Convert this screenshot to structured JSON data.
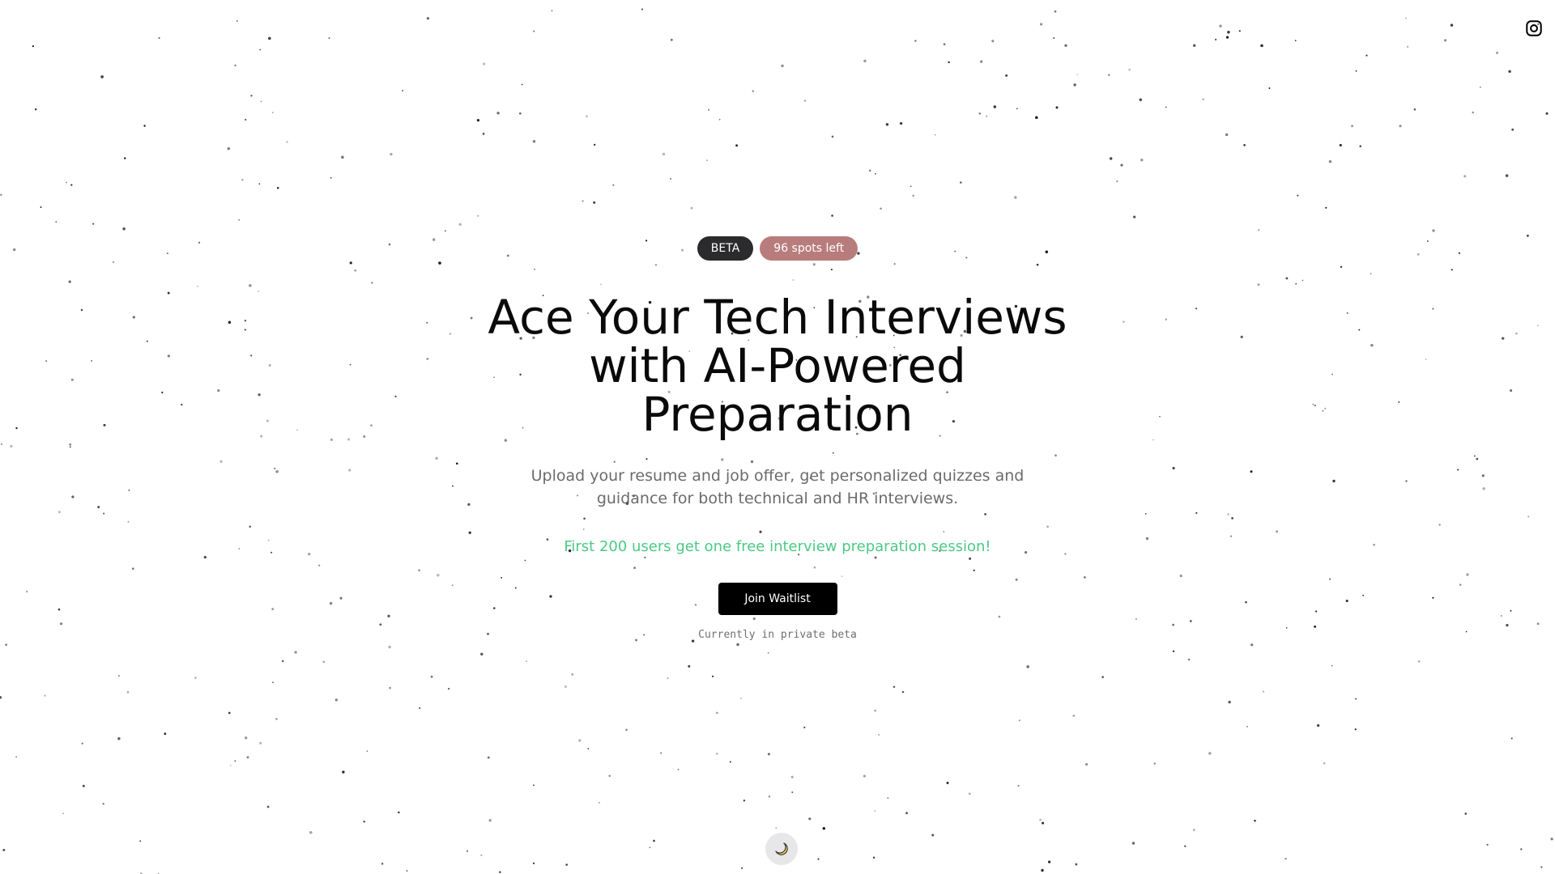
{
  "header": {
    "social_icon": "instagram-icon"
  },
  "hero": {
    "badges": {
      "beta": "BETA",
      "spots": "96 spots left"
    },
    "headline": "Ace Your Tech Interviews with AI-Powered Preparation",
    "subtitle": "Upload your resume and job offer, get personalized quizzes and guidance for both technical and HR interviews.",
    "promo": "First 200 users get one free interview preparation session!",
    "cta_label": "Join Waitlist",
    "beta_note": "Currently in private beta"
  },
  "footer": {
    "theme_toggle_icon": "moon-icon"
  },
  "colors": {
    "background": "#ffffff",
    "beta_badge": "#2b2b2d",
    "spots_badge": "#b97c7c",
    "promo_text": "#4cc984",
    "button": "#000000",
    "toggle_bg": "#e7e7e9",
    "moon": "#f2c94c"
  }
}
